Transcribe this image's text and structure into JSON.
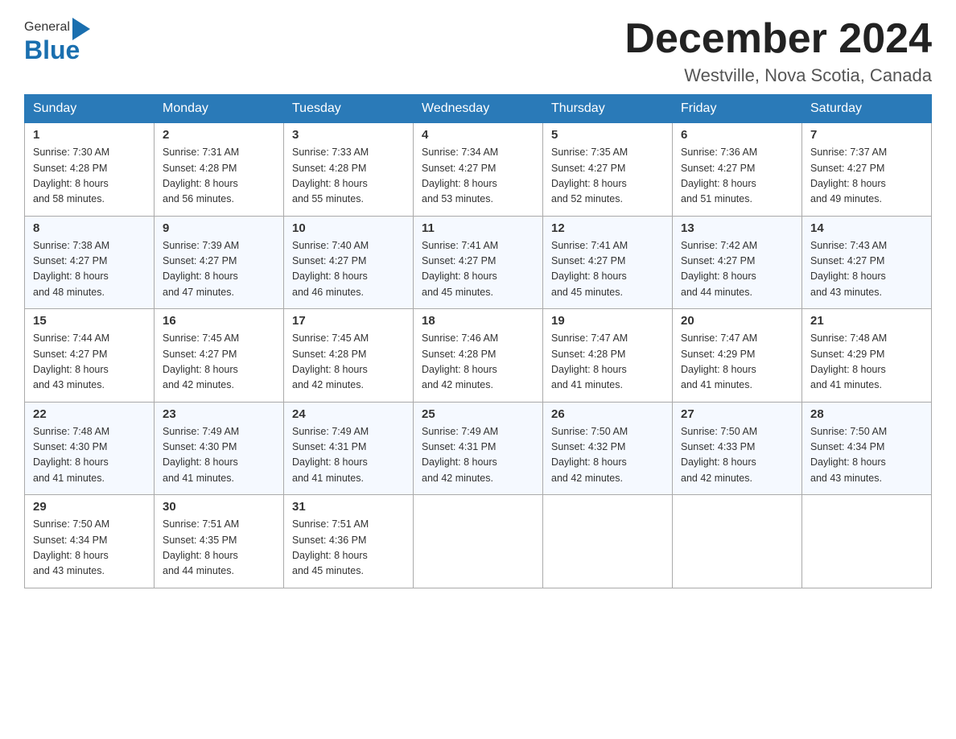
{
  "header": {
    "logo_general": "General",
    "logo_blue": "Blue",
    "month_title": "December 2024",
    "location": "Westville, Nova Scotia, Canada"
  },
  "calendar": {
    "days_of_week": [
      "Sunday",
      "Monday",
      "Tuesday",
      "Wednesday",
      "Thursday",
      "Friday",
      "Saturday"
    ],
    "weeks": [
      [
        {
          "day": "1",
          "sunrise": "7:30 AM",
          "sunset": "4:28 PM",
          "daylight": "8 hours and 58 minutes."
        },
        {
          "day": "2",
          "sunrise": "7:31 AM",
          "sunset": "4:28 PM",
          "daylight": "8 hours and 56 minutes."
        },
        {
          "day": "3",
          "sunrise": "7:33 AM",
          "sunset": "4:28 PM",
          "daylight": "8 hours and 55 minutes."
        },
        {
          "day": "4",
          "sunrise": "7:34 AM",
          "sunset": "4:27 PM",
          "daylight": "8 hours and 53 minutes."
        },
        {
          "day": "5",
          "sunrise": "7:35 AM",
          "sunset": "4:27 PM",
          "daylight": "8 hours and 52 minutes."
        },
        {
          "day": "6",
          "sunrise": "7:36 AM",
          "sunset": "4:27 PM",
          "daylight": "8 hours and 51 minutes."
        },
        {
          "day": "7",
          "sunrise": "7:37 AM",
          "sunset": "4:27 PM",
          "daylight": "8 hours and 49 minutes."
        }
      ],
      [
        {
          "day": "8",
          "sunrise": "7:38 AM",
          "sunset": "4:27 PM",
          "daylight": "8 hours and 48 minutes."
        },
        {
          "day": "9",
          "sunrise": "7:39 AM",
          "sunset": "4:27 PM",
          "daylight": "8 hours and 47 minutes."
        },
        {
          "day": "10",
          "sunrise": "7:40 AM",
          "sunset": "4:27 PM",
          "daylight": "8 hours and 46 minutes."
        },
        {
          "day": "11",
          "sunrise": "7:41 AM",
          "sunset": "4:27 PM",
          "daylight": "8 hours and 45 minutes."
        },
        {
          "day": "12",
          "sunrise": "7:41 AM",
          "sunset": "4:27 PM",
          "daylight": "8 hours and 45 minutes."
        },
        {
          "day": "13",
          "sunrise": "7:42 AM",
          "sunset": "4:27 PM",
          "daylight": "8 hours and 44 minutes."
        },
        {
          "day": "14",
          "sunrise": "7:43 AM",
          "sunset": "4:27 PM",
          "daylight": "8 hours and 43 minutes."
        }
      ],
      [
        {
          "day": "15",
          "sunrise": "7:44 AM",
          "sunset": "4:27 PM",
          "daylight": "8 hours and 43 minutes."
        },
        {
          "day": "16",
          "sunrise": "7:45 AM",
          "sunset": "4:27 PM",
          "daylight": "8 hours and 42 minutes."
        },
        {
          "day": "17",
          "sunrise": "7:45 AM",
          "sunset": "4:28 PM",
          "daylight": "8 hours and 42 minutes."
        },
        {
          "day": "18",
          "sunrise": "7:46 AM",
          "sunset": "4:28 PM",
          "daylight": "8 hours and 42 minutes."
        },
        {
          "day": "19",
          "sunrise": "7:47 AM",
          "sunset": "4:28 PM",
          "daylight": "8 hours and 41 minutes."
        },
        {
          "day": "20",
          "sunrise": "7:47 AM",
          "sunset": "4:29 PM",
          "daylight": "8 hours and 41 minutes."
        },
        {
          "day": "21",
          "sunrise": "7:48 AM",
          "sunset": "4:29 PM",
          "daylight": "8 hours and 41 minutes."
        }
      ],
      [
        {
          "day": "22",
          "sunrise": "7:48 AM",
          "sunset": "4:30 PM",
          "daylight": "8 hours and 41 minutes."
        },
        {
          "day": "23",
          "sunrise": "7:49 AM",
          "sunset": "4:30 PM",
          "daylight": "8 hours and 41 minutes."
        },
        {
          "day": "24",
          "sunrise": "7:49 AM",
          "sunset": "4:31 PM",
          "daylight": "8 hours and 41 minutes."
        },
        {
          "day": "25",
          "sunrise": "7:49 AM",
          "sunset": "4:31 PM",
          "daylight": "8 hours and 42 minutes."
        },
        {
          "day": "26",
          "sunrise": "7:50 AM",
          "sunset": "4:32 PM",
          "daylight": "8 hours and 42 minutes."
        },
        {
          "day": "27",
          "sunrise": "7:50 AM",
          "sunset": "4:33 PM",
          "daylight": "8 hours and 42 minutes."
        },
        {
          "day": "28",
          "sunrise": "7:50 AM",
          "sunset": "4:34 PM",
          "daylight": "8 hours and 43 minutes."
        }
      ],
      [
        {
          "day": "29",
          "sunrise": "7:50 AM",
          "sunset": "4:34 PM",
          "daylight": "8 hours and 43 minutes."
        },
        {
          "day": "30",
          "sunrise": "7:51 AM",
          "sunset": "4:35 PM",
          "daylight": "8 hours and 44 minutes."
        },
        {
          "day": "31",
          "sunrise": "7:51 AM",
          "sunset": "4:36 PM",
          "daylight": "8 hours and 45 minutes."
        },
        null,
        null,
        null,
        null
      ]
    ],
    "labels": {
      "sunrise": "Sunrise:",
      "sunset": "Sunset:",
      "daylight": "Daylight:"
    }
  }
}
